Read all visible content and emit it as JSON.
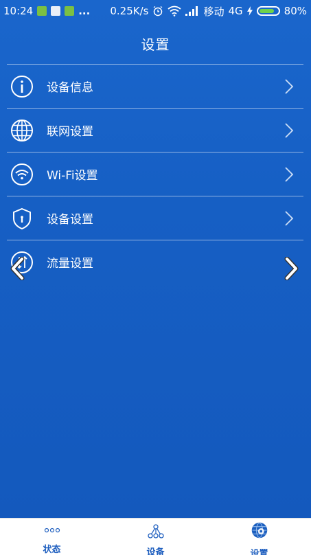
{
  "statusbar": {
    "time": "10:24",
    "more": "...",
    "speed": "0.25K/s",
    "carrier": "移动",
    "network": "4G",
    "battery": "80%",
    "battery_level": 0.8
  },
  "header": {
    "title": "设置"
  },
  "menu": [
    {
      "label": "设备信息",
      "icon": "info-icon"
    },
    {
      "label": "联网设置",
      "icon": "globe-icon"
    },
    {
      "label": "Wi-Fi设置",
      "icon": "wifi-icon"
    },
    {
      "label": "设备设置",
      "icon": "shield-icon"
    },
    {
      "label": "流量设置",
      "icon": "data-flow-icon"
    }
  ],
  "tabbar": [
    {
      "label": "状态",
      "icon": "dots-icon",
      "active": false
    },
    {
      "label": "设备",
      "icon": "network-nodes-icon",
      "active": false
    },
    {
      "label": "设置",
      "icon": "settings-globe-icon",
      "active": true
    }
  ],
  "colors": {
    "background": "#1a66cc",
    "tab_label": "#1f5fbf",
    "battery_fill": "#6fd24a"
  }
}
